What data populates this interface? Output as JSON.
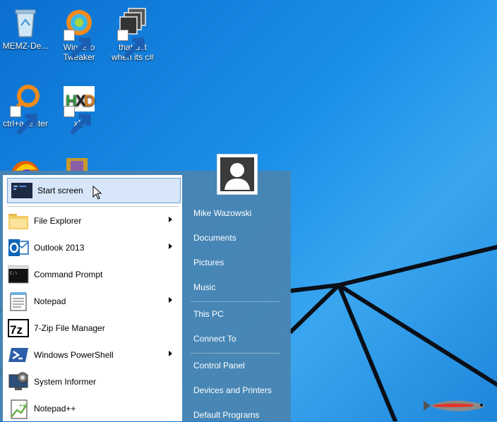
{
  "desktop": {
    "icons": [
      {
        "label": "MEMZ-De...",
        "icon": "recycle-bin-icon"
      },
      {
        "label": "Winaero Tweaker",
        "icon": "winaero-icon"
      },
      {
        "label": "that but when its c#",
        "icon": "stacked-windows-icon"
      },
      {
        "label": "ctrl+a, enter",
        "icon": "search-icon"
      },
      {
        "label": "xD",
        "icon": "hxd-icon"
      }
    ]
  },
  "start_menu": {
    "items": [
      {
        "label": "Start screen",
        "icon": "start-screen-icon",
        "submenu": false,
        "selected": true
      },
      {
        "label": "File Explorer",
        "icon": "folder-icon",
        "submenu": true
      },
      {
        "label": "Outlook 2013",
        "icon": "outlook-icon",
        "submenu": true
      },
      {
        "label": "Command Prompt",
        "icon": "command-prompt-icon",
        "submenu": false
      },
      {
        "label": "Notepad",
        "icon": "notepad-icon",
        "submenu": true
      },
      {
        "label": "7-Zip File Manager",
        "icon": "7zip-icon",
        "submenu": false
      },
      {
        "label": "Windows PowerShell",
        "icon": "powershell-icon",
        "submenu": true
      },
      {
        "label": "System Informer",
        "icon": "system-informer-icon",
        "submenu": false
      },
      {
        "label": "Notepad++",
        "icon": "notepadpp-icon",
        "submenu": false
      }
    ],
    "right": {
      "user": "Mike Wazowski",
      "links": [
        "Documents",
        "Pictures",
        "Music",
        "This PC",
        "Connect To",
        "Control Panel",
        "Devices and Printers",
        "Default Programs"
      ]
    }
  },
  "colors": {
    "desktop": "#1b8fe8",
    "menu_panel": "#4a84b0",
    "selection": "#d7e6f8"
  }
}
